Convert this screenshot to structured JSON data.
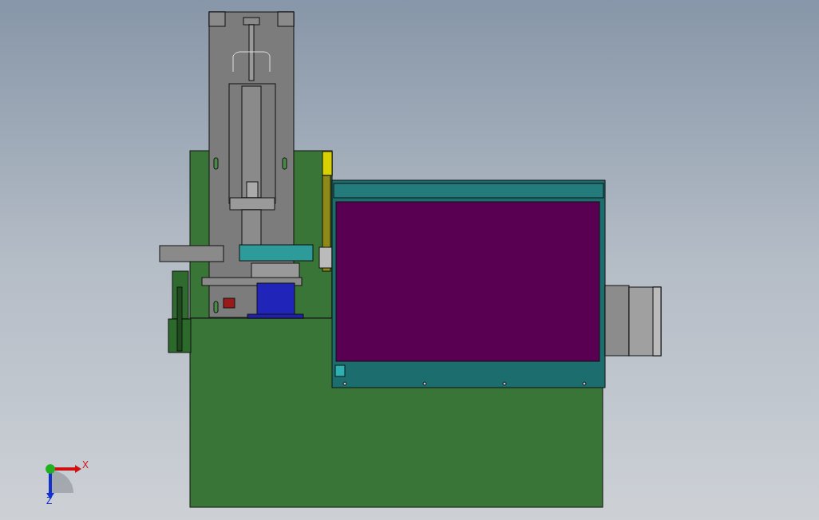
{
  "triad": {
    "x_label": "X",
    "z_label": "Z"
  }
}
